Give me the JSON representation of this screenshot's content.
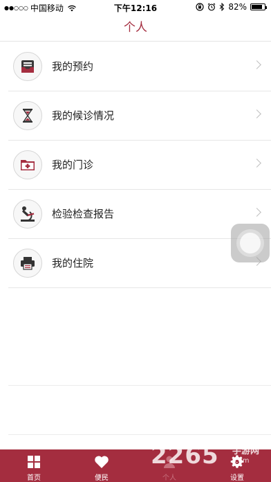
{
  "status_bar": {
    "signal": "●●○○○",
    "carrier": "中国移动",
    "time": "下午12:16",
    "battery_text": "82%",
    "battery_level": 0.82
  },
  "header": {
    "title": "个人"
  },
  "menu": {
    "items": [
      {
        "label": "我的预约",
        "icon": "inbox-tray-icon"
      },
      {
        "label": "我的候诊情况",
        "icon": "hourglass-icon"
      },
      {
        "label": "我的门诊",
        "icon": "medical-folder-icon"
      },
      {
        "label": "检验检查报告",
        "icon": "microscope-icon"
      },
      {
        "label": "我的住院",
        "icon": "printer-icon"
      }
    ]
  },
  "tab_bar": {
    "active_index": 2,
    "tabs": [
      {
        "label": "首页",
        "icon": "grid-icon"
      },
      {
        "label": "便民",
        "icon": "heart-icon"
      },
      {
        "label": "个人",
        "icon": "person-icon"
      },
      {
        "label": "设置",
        "icon": "gear-icon"
      }
    ]
  },
  "watermark": {
    "number": "2265",
    "text": "手游网",
    "url": ".com"
  },
  "colors": {
    "accent": "#a42d3f",
    "divider": "#e6e6e6",
    "chevron": "#bfbfbf"
  }
}
